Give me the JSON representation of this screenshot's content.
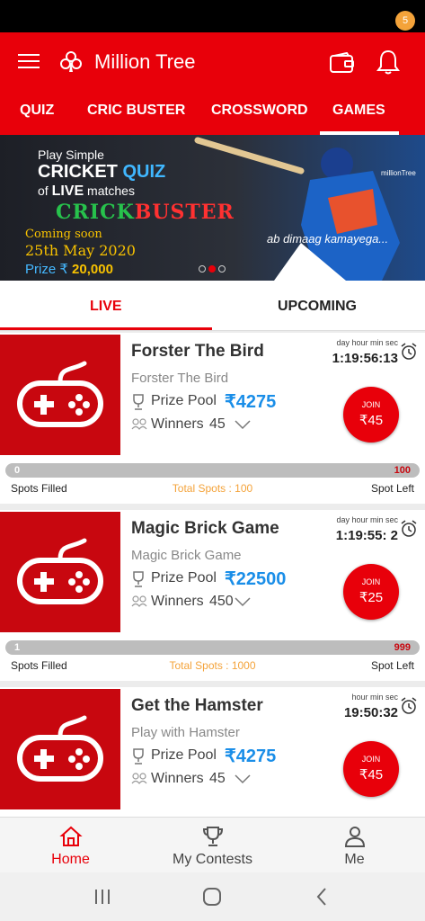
{
  "app": {
    "title": "Million Tree",
    "notification_count": "5"
  },
  "tabs": [
    {
      "label": "QUIZ"
    },
    {
      "label": "CRIC BUSTER"
    },
    {
      "label": "CROSSWORD"
    },
    {
      "label": "GAMES"
    }
  ],
  "banner": {
    "line1": "Play Simple",
    "line2a": "CRICKET ",
    "line2b": "QUIZ",
    "line3a": "of ",
    "line3b": "LIVE",
    "line3c": " matches",
    "brand_a": "CRICK",
    "brand_b": "BUSTER",
    "coming": "Coming soon",
    "date": "25th May 2020",
    "prize_label": "Prize ₹",
    "prize_value": " 20,000",
    "tagline": "ab dimaag kamayega...",
    "logo_text": "millionTree"
  },
  "segments": {
    "live": "LIVE",
    "upcoming": "UPCOMING"
  },
  "labels": {
    "prize_pool": "Prize Pool",
    "winners": "Winners",
    "join": "JOIN",
    "spots_filled": "Spots Filled",
    "spot_left": "Spot Left"
  },
  "games": [
    {
      "name": "Forster The Bird",
      "subtitle": "Forster The Bird",
      "prize": "₹4275",
      "winners": "45",
      "time_label": "day hour min sec",
      "timer": "1:19:56:13",
      "entry": "₹45",
      "filled": "0",
      "left": "100",
      "fill_fraction": 0.0,
      "total": "Total Spots : 100"
    },
    {
      "name": "Magic Brick Game",
      "subtitle": "Magic Brick Game",
      "prize": "₹22500",
      "winners": "450",
      "time_label": "day hour min sec",
      "timer": "1:19:55: 2",
      "entry": "₹25",
      "filled": "1",
      "left": "999",
      "fill_fraction": 0.001,
      "total": "Total Spots : 1000"
    },
    {
      "name": "Get the Hamster",
      "subtitle": "Play with Hamster",
      "prize": "₹4275",
      "winners": "45",
      "time_label": "hour min sec",
      "timer": "19:50:32",
      "entry": "₹45",
      "filled": "",
      "left": "",
      "fill_fraction": 0.02,
      "total": ""
    }
  ],
  "bottom_nav": [
    {
      "label": "Home"
    },
    {
      "label": "My Contests"
    },
    {
      "label": "Me"
    }
  ],
  "colors": {
    "primary": "#e8000a",
    "accent_blue": "#1a8ee8",
    "accent_orange": "#f4a33a"
  },
  "icons": [
    "menu-icon",
    "club-logo-icon",
    "wallet-icon",
    "bell-icon",
    "gamepad-icon",
    "trophy-icon",
    "group-icon",
    "chevron-down-icon",
    "alarm-clock-icon",
    "home-icon",
    "contests-trophy-icon",
    "profile-icon",
    "recents-icon",
    "home-circle-icon",
    "back-icon"
  ]
}
